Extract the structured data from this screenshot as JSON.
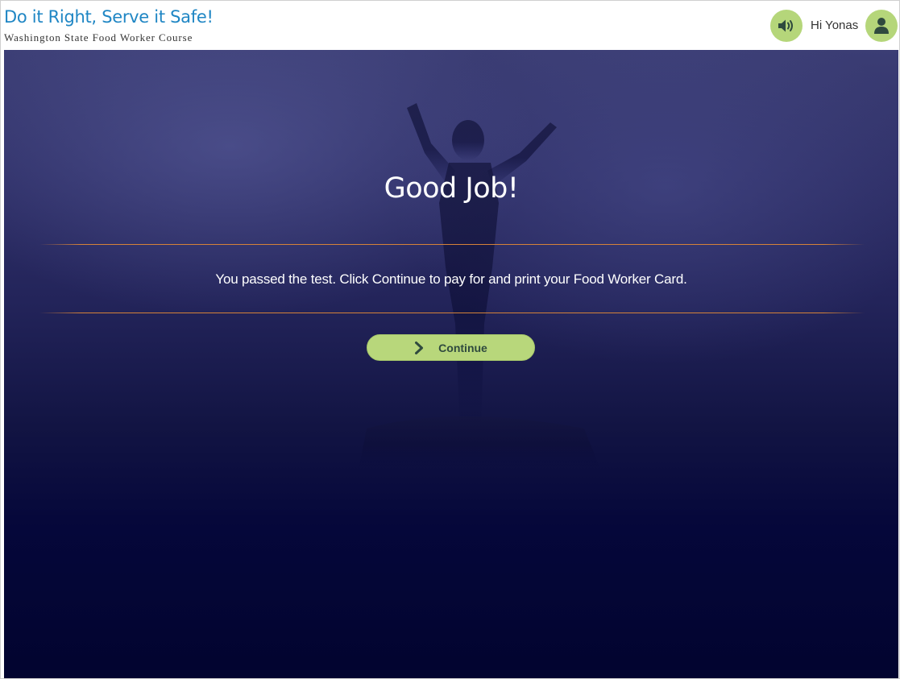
{
  "header": {
    "title": "Do it Right, Serve it Safe!",
    "subtitle": "Washington State Food Worker Course",
    "greeting": "Hi Yonas",
    "audio_icon": "speaker-icon",
    "user_icon": "user-icon",
    "accent_color": "#1f86c4",
    "button_color": "#b5d67a"
  },
  "main": {
    "heading": "Good Job!",
    "message": "You passed the test. Click Continue to pay for and print your Food Worker Card.",
    "continue_label": "Continue",
    "continue_icon": "chevron-right-icon",
    "divider_color": "#d58238",
    "background_image": "celebrating-person-silhouette"
  }
}
